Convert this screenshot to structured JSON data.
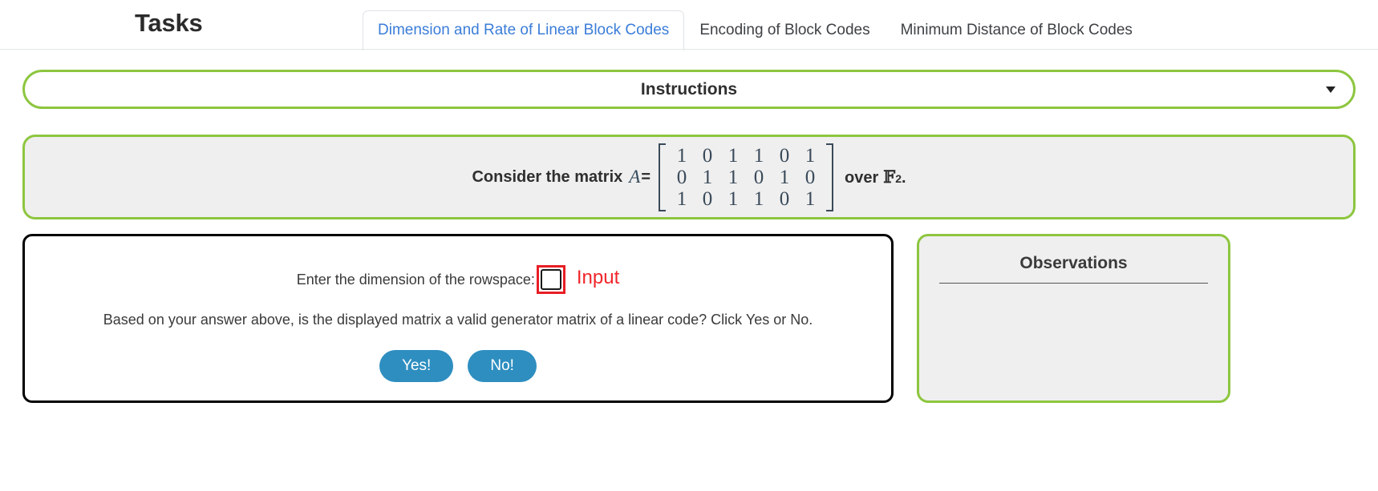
{
  "header": {
    "app_title": "Tasks",
    "tabs": [
      {
        "label": "Dimension and Rate of Linear Block Codes",
        "active": true
      },
      {
        "label": "Encoding of Block Codes",
        "active": false
      },
      {
        "label": "Minimum Distance of Block Codes",
        "active": false
      }
    ]
  },
  "instructions": {
    "label": "Instructions",
    "caret_icon": "chevron-down-icon",
    "expanded": false
  },
  "problem": {
    "lead_text": "Consider the matrix",
    "variable": "A",
    "equals": "=",
    "matrix": [
      [
        "1",
        "0",
        "1",
        "1",
        "0",
        "1"
      ],
      [
        "0",
        "1",
        "1",
        "0",
        "1",
        "0"
      ],
      [
        "1",
        "0",
        "1",
        "1",
        "0",
        "1"
      ]
    ],
    "trailing_text": "over",
    "field_symbol": "F",
    "field_subscript": "2",
    "trailing_period": "."
  },
  "answer": {
    "dimension_label": "Enter the dimension of the rowspace:",
    "dimension_value": "",
    "dimension_placeholder": "",
    "annotation_label": "Input",
    "annotation_color": "#f0262b",
    "question_text": "Based on your answer above, is the displayed matrix a valid generator matrix of a linear code? Click Yes or No.",
    "yes_label": "Yes!",
    "no_label": "No!",
    "button_color": "#2e8ec0"
  },
  "observations": {
    "title": "Observations",
    "entries": []
  },
  "theme": {
    "accent_green": "#8dc63f",
    "panel_gray": "#efefef",
    "tab_active_color": "#3b7dd8"
  }
}
